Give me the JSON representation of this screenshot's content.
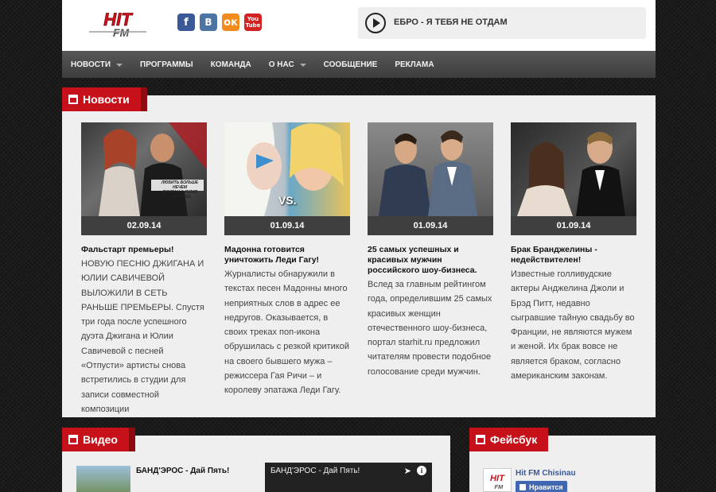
{
  "header": {
    "logo_text": "HIT FM",
    "socials": [
      {
        "name": "facebook",
        "glyph": "f"
      },
      {
        "name": "vkontakte",
        "glyph": "В"
      },
      {
        "name": "odnoklassniki",
        "glyph": "ок"
      },
      {
        "name": "youtube",
        "glyph_top": "You",
        "glyph_bottom": "Tube"
      }
    ],
    "player": {
      "now_playing": "ЕБРО - Я ТЕБЯ НЕ ОТДАМ"
    }
  },
  "nav": {
    "items": [
      {
        "label": "НОВОСТИ",
        "dropdown": true
      },
      {
        "label": "ПРОГРАММЫ",
        "dropdown": false
      },
      {
        "label": "КОМАНДА",
        "dropdown": false
      },
      {
        "label": "О НАС",
        "dropdown": true
      },
      {
        "label": "СООБЩЕНИЕ",
        "dropdown": false
      },
      {
        "label": "РЕКЛАМА",
        "dropdown": false
      }
    ]
  },
  "news": {
    "heading": "Новости",
    "cards": [
      {
        "thumb_caption": "ЛЮБИТЬ БОЛЬШЕ НЕЧЕМ\nДЖИГАН & ЮЛИЯ САВИЧЕВА",
        "date": "02.09.14",
        "title": "Фальстарт премьеры!",
        "text": "НОВУЮ ПЕСНЮ ДЖИГАНА И ЮЛИИ САВИЧЕВОЙ ВЫЛОЖИЛИ В СЕТЬ РАНЬШЕ ПРЕМЬЕРЫ. Спустя три года после успешного дуэта Джигана и Юлии Савичевой с песней «Отпусти» артисты снова встретились в студии для записи совместной композиции"
      },
      {
        "thumb_caption": "VS.",
        "date": "01.09.14",
        "title": "Мадонна готовится уничтожить Леди Гагу!",
        "text": "Журналисты обнаружили в текстах песен Мадонны много неприятных слов в адрес ее недругов. Оказывается, в своих треках поп-икона обрушилась с резкой критикой на своего бывшего мужа – режиссера Гая Ричи – и королеву эпатажа Леди Гагу."
      },
      {
        "thumb_caption": "",
        "date": "01.09.14",
        "title": "25 самых успешных и красивых мужчин российского шоу-бизнеса.",
        "text": "Вслед за главным рейтингом года, определившим 25 самых красивых женщин отечественного шоу-бизнеса, портал starhit.ru предложил читателям провести подобное голосование среди мужчин."
      },
      {
        "thumb_caption": "",
        "date": "01.09.14",
        "title": "Брак Бранджелины - недействителен!",
        "text": "Известные голливудские актеры Анджелина Джоли и Брэд Питт, недавно сыгравшие тайную свадьбу во Франции, не являются мужем и женой. Их брак вовсе не является браком, согласно американским законам."
      }
    ]
  },
  "video": {
    "heading": "Видео",
    "item_title": "БАНД'ЭРОС - Дай Пять!",
    "player_title": "БАНД'ЭРОС - Дай Пять!"
  },
  "facebook": {
    "heading": "Фейсбук",
    "page_name": "Hit FM Chisinau",
    "like_label": "Нравится"
  },
  "colors": {
    "accent_red": "#c6111a",
    "nav_gray": "#4a4a4a",
    "date_bar": "#3f3f3f",
    "facebook_blue": "#3b5998"
  }
}
